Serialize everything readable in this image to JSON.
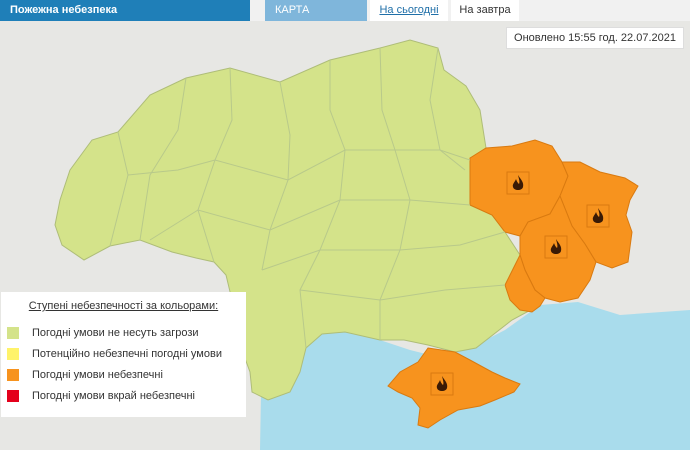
{
  "header": {
    "title": "Пожежна небезпека",
    "map_tab": "КАРТА УКРАЇНИ",
    "today_tab": "На сьогодні",
    "tomorrow_tab": "На завтра"
  },
  "updated": "Оновлено 15:55 год. 22.07.2021",
  "legend": {
    "title": "Ступені небезпечності за кольорами:",
    "items": [
      {
        "label": "Погодні умови не несуть загрози",
        "color": "#d4e38a"
      },
      {
        "label": "Потенційно небезпечні погодні умови",
        "color": "#fff36a"
      },
      {
        "label": "Погодні умови небезпечні",
        "color": "#f7931e"
      },
      {
        "label": "Погодні умови вкрай небезпечні",
        "color": "#e4001b"
      }
    ]
  },
  "map": {
    "colors": {
      "safe": "#d4e38a",
      "dangerous": "#f7931e",
      "sea": "#a9dcec",
      "land_outside": "#e7e7e4",
      "borders": "#b8c98a"
    },
    "dangerous_regions": [
      "Харківська",
      "Луганська",
      "Донецька",
      "Запорізька",
      "АР Крим"
    ],
    "fire_marker_icon": "fire-icon",
    "fire_markers": 4
  }
}
